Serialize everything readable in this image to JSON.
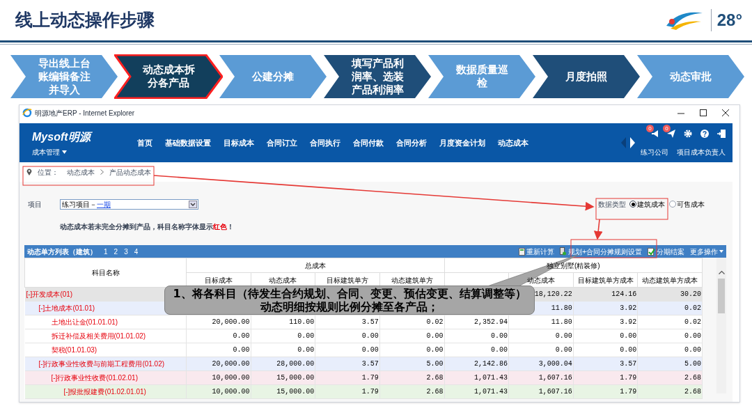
{
  "slide": {
    "title": "线上动态操作步骤",
    "logo_text": "28°"
  },
  "steps": [
    {
      "label": "导出线上台账编辑备注并导入",
      "color": "#5b9bd5",
      "selected": false
    },
    {
      "label": "动态成本拆分各产品",
      "color": "#123f5c",
      "selected": true
    },
    {
      "label": "公建分摊",
      "color": "#5b9bd5",
      "selected": false
    },
    {
      "label": "填写产品利润率、选装产品利润率",
      "color": "#1f4e79",
      "selected": false
    },
    {
      "label": "数据质量巡检",
      "color": "#5b9bd5",
      "selected": false
    },
    {
      "label": "月度拍照",
      "color": "#1f4e79",
      "selected": false
    },
    {
      "label": "动态审批",
      "color": "#5b9bd5",
      "selected": false
    }
  ],
  "window": {
    "title": "明源地产ERP - Internet Explorer"
  },
  "app": {
    "brand": "Mysoft明源",
    "module": "成本管理",
    "nav": [
      "首页",
      "基础数据设置",
      "目标成本",
      "合同订立",
      "合同执行",
      "合同付款",
      "合同分析",
      "月度资金计划",
      "动态成本"
    ],
    "badges": [
      "0",
      "0"
    ],
    "company": "练习公司",
    "role": "项目成本负责人"
  },
  "breadcrumb": {
    "label": "位置：",
    "path": [
      "动态成本",
      "产品动态成本"
    ]
  },
  "project": {
    "label": "项目",
    "value": "练习项目－",
    "link": "一期"
  },
  "notice": "动态成本若未完全分摊到产品，科目名称字体显示**红色**！",
  "data_type": {
    "label": "数据类型",
    "options": [
      {
        "label": "建筑成本",
        "selected": true
      },
      {
        "label": "可售成本",
        "selected": false
      }
    ]
  },
  "table": {
    "title": "动态单方列表（建筑）",
    "pages": [
      "1",
      "2",
      "3",
      "4"
    ],
    "toolbar": [
      "重新计算",
      "规划+合同分摊规则设置",
      "分期结案",
      "更多操作"
    ],
    "name_header": "科目名称",
    "groups": [
      {
        "label": "总成本"
      },
      {
        "label": "独立别墅(精装修)"
      }
    ],
    "columns": [
      {
        "label": "目标成本"
      },
      {
        "label": "动态成本"
      },
      {
        "label": "目标建筑单方"
      },
      {
        "label": "动态建筑单方"
      },
      {},
      {
        "label": "动态成本"
      },
      {
        "label": "目标建筑单方成本"
      },
      {
        "label": "动态建筑单方成本"
      }
    ],
    "rows": [
      {
        "toggle": "[-]",
        "name": "开发成本(01)",
        "values": [
          "18,120.22",
          "124.16",
          "30.20"
        ],
        "children": [
          {
            "toggle": "[-]",
            "name": "土地成本(01.01)",
            "values": [
              "11.80",
              "3.92",
              "0.02"
            ],
            "children": [
              {
                "name": "土地出让金(01.01.01)",
                "values": [
                  "20,000.00",
                  "110.00",
                  "3.57",
                  "0.02",
                  "2,352.94",
                  "11.80",
                  "3.92",
                  "0.02"
                ]
              },
              {
                "name": "拆迁补偿及相关费用(01.01.02)",
                "values": [
                  "0.00",
                  "0.00",
                  "0.00",
                  "0.00",
                  "0.00",
                  "0.00",
                  "0.00",
                  "0.00"
                ]
              },
              {
                "name": "契税(01.01.03)",
                "values": [
                  "0.00",
                  "0.00",
                  "0.00",
                  "0.00",
                  "0.00",
                  "0.00",
                  "0.00",
                  "0.00"
                ]
              }
            ]
          },
          {
            "toggle": "[-]",
            "name": "行政事业性收费与前期工程费用(01.02)",
            "values": [
              "20,000.00",
              "28,000.00",
              "3.57",
              "5.00",
              "2,142.86",
              "3,000.04",
              "3.57",
              "5.00"
            ],
            "children": [
              {
                "toggle": "[-]",
                "name": "行政事业性收费(01.02.01)",
                "values": [
                  "10,000.00",
                  "15,000.00",
                  "1.79",
                  "2.68",
                  "1,071.43",
                  "1,607.16",
                  "1.79",
                  "2.68"
                ],
                "children": [
                  {
                    "toggle": "[-]",
                    "name": "报批报建费(01.02.01.01)",
                    "values": [
                      "10,000.00",
                      "15,000.00",
                      "1.79",
                      "2.68",
                      "1,071.43",
                      "1,607.16",
                      "1.79",
                      "2.68"
                    ]
                  }
                ]
              }
            ]
          }
        ]
      }
    ]
  },
  "callout": "1、将各科目（待发生合约规划、合同、变更、预估变更、结算调整等）动态明细按规则比例分摊至各产品；"
}
